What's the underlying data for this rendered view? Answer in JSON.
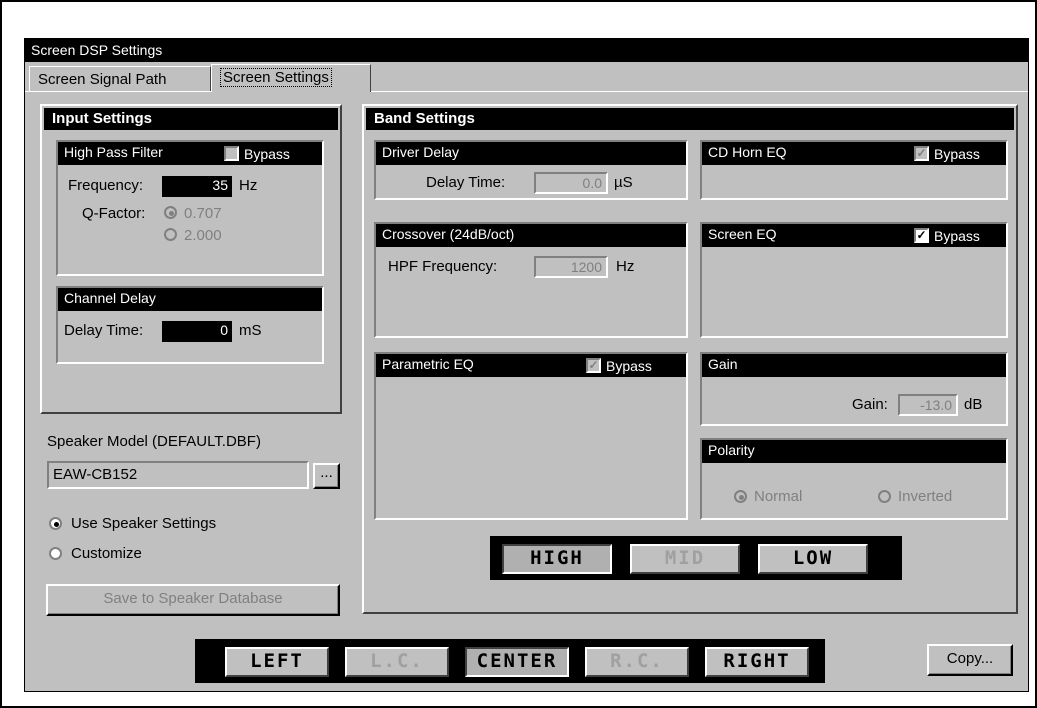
{
  "window": {
    "title": "Screen DSP Settings"
  },
  "tabs": [
    {
      "label": "Screen Signal Path"
    },
    {
      "label": "Screen Settings"
    }
  ],
  "input_settings": {
    "title": "Input Settings",
    "high_pass_filter": {
      "title": "High Pass Filter",
      "bypass_label": "Bypass",
      "bypass_checked": false,
      "frequency_label": "Frequency:",
      "frequency_value": "35",
      "frequency_unit": "Hz",
      "q_factor_label": "Q-Factor:",
      "q_options": [
        "0.707",
        "2.000"
      ],
      "q_selected": "0.707"
    },
    "channel_delay": {
      "title": "Channel Delay",
      "delay_label": "Delay Time:",
      "delay_value": "0",
      "delay_unit": "mS"
    }
  },
  "speaker": {
    "model_label": "Speaker Model (DEFAULT.DBF)",
    "model_value": "EAW-CB152",
    "browse_label": "...",
    "use_speaker_label": "Use Speaker Settings",
    "customize_label": "Customize",
    "selected": "use_speaker",
    "save_label": "Save to Speaker Database"
  },
  "band_settings": {
    "title": "Band Settings",
    "driver_delay": {
      "title": "Driver Delay",
      "delay_label": "Delay Time:",
      "delay_value": "0.0",
      "delay_unit": "µS"
    },
    "crossover": {
      "title": "Crossover (24dB/oct)",
      "hpf_label": "HPF Frequency:",
      "hpf_value": "1200",
      "hpf_unit": "Hz"
    },
    "parametric_eq": {
      "title": "Parametric EQ",
      "bypass_label": "Bypass",
      "bypass_checked": true
    },
    "cd_horn_eq": {
      "title": "CD Horn EQ",
      "bypass_label": "Bypass",
      "bypass_checked": true
    },
    "screen_eq": {
      "title": "Screen EQ",
      "bypass_label": "Bypass",
      "bypass_checked": true
    },
    "gain": {
      "title": "Gain",
      "gain_label": "Gain:",
      "gain_value": "-13.0",
      "gain_unit": "dB"
    },
    "polarity": {
      "title": "Polarity",
      "normal_label": "Normal",
      "inverted_label": "Inverted",
      "selected": "normal"
    },
    "bands": [
      {
        "label": "HIGH",
        "state": "selected"
      },
      {
        "label": "MID",
        "state": "disabled"
      },
      {
        "label": "LOW",
        "state": "enabled"
      }
    ]
  },
  "channels": [
    {
      "label": "LEFT",
      "state": "enabled"
    },
    {
      "label": "L.C.",
      "state": "disabled"
    },
    {
      "label": "CENTER",
      "state": "selected"
    },
    {
      "label": "R.C.",
      "state": "disabled"
    },
    {
      "label": "RIGHT",
      "state": "enabled"
    }
  ],
  "copy_label": "Copy..."
}
